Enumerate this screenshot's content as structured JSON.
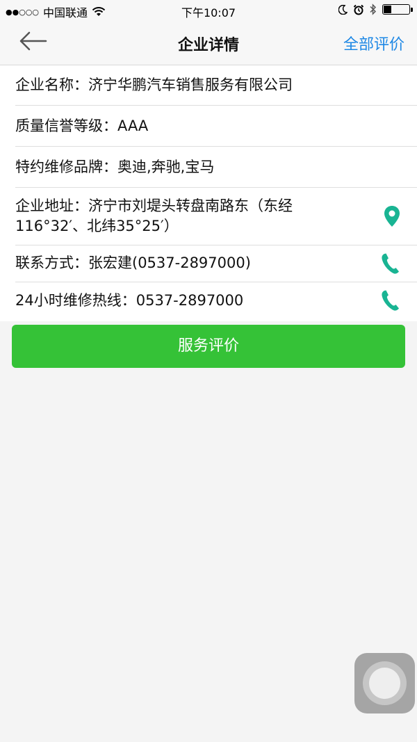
{
  "status_bar": {
    "signal": "●●○○○",
    "carrier": "中国联通",
    "time": "下午10:07",
    "battery_level": 0.28
  },
  "nav": {
    "title": "企业详情",
    "right_label": "全部评价"
  },
  "info": {
    "name": "企业名称：济宁华鹏汽车销售服务有限公司",
    "quality": "质量信誉等级：AAA",
    "brands": "特约维修品牌：奥迪,奔驰,宝马",
    "address": "企业地址：济宁市刘堤头转盘南路东（东经116°32′、北纬35°25′）",
    "contact": "联系方式：张宏建(0537-2897000)",
    "hotline": "24小时维修热线：0537-2897000"
  },
  "review_button": "服务评价",
  "colors": {
    "accent_green": "#35c237",
    "link_blue": "#1e88e5",
    "icon_teal": "#19b493"
  }
}
